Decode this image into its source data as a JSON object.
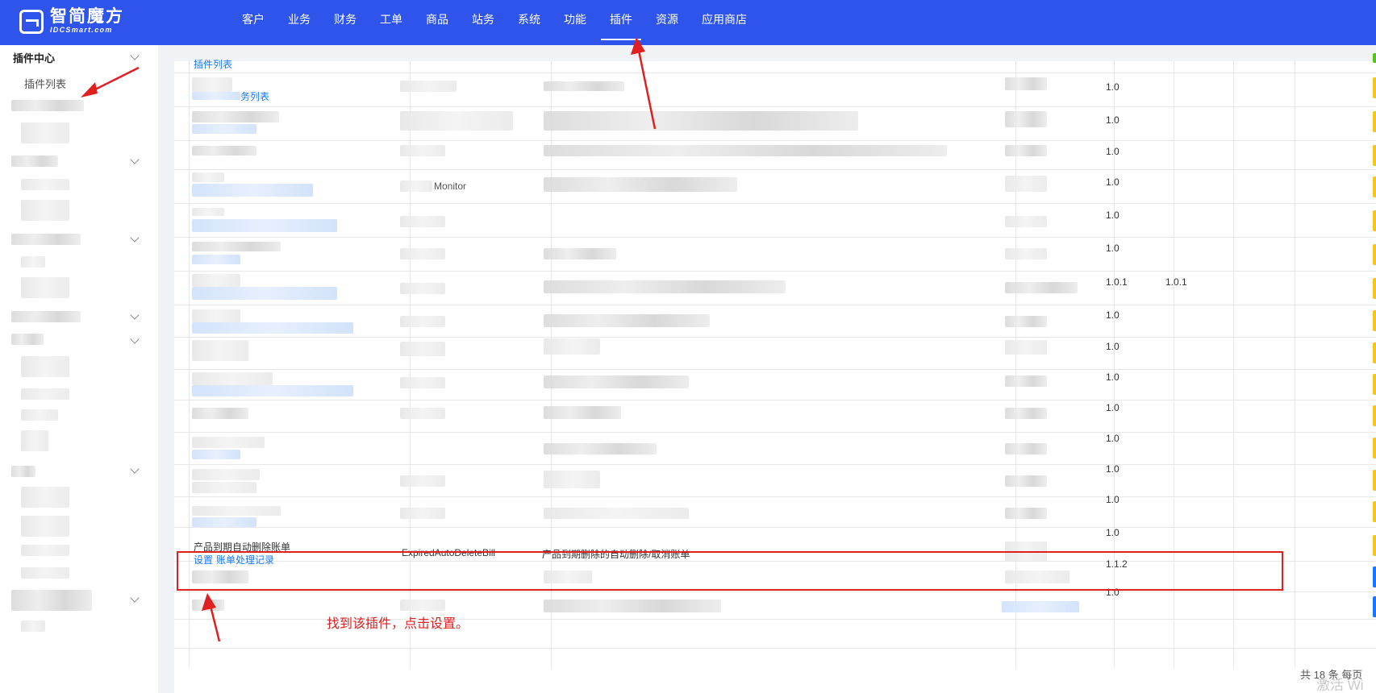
{
  "brand": {
    "name": "智简魔方",
    "sub": "IDCSmart.com"
  },
  "nav": {
    "items": [
      {
        "label": "客户"
      },
      {
        "label": "业务"
      },
      {
        "label": "财务"
      },
      {
        "label": "工单"
      },
      {
        "label": "商品"
      },
      {
        "label": "站务"
      },
      {
        "label": "系统"
      },
      {
        "label": "功能"
      },
      {
        "label": "插件",
        "active": true
      },
      {
        "label": "资源"
      },
      {
        "label": "应用商店"
      }
    ]
  },
  "sidebar": {
    "group_title": "插件中心",
    "active_item": "插件列表"
  },
  "table": {
    "top_link": "插件列表",
    "row2_link": "务列表",
    "versions": [
      "1.0",
      "1.0",
      "1.0",
      "1.0",
      "1.0",
      "1.0",
      "1.0.1",
      "1.0",
      "1.0",
      "1.0",
      "1.0",
      "1.0",
      "1.0",
      "1.0",
      "1.0",
      "1.1.2",
      "1.0"
    ],
    "row7_latest": "1.0.1",
    "row3_mono": "Monitor",
    "highlighted_row": {
      "name": "产品到期自动删除账单",
      "action_settings": "设置",
      "action_records": "账单处理记录",
      "identifier": "ExpiredAutoDeleteBill",
      "description": "产品到期删除的自动删除/取消账单",
      "version": "1.0"
    }
  },
  "annotation": {
    "note": "找到该插件，点击设置。"
  },
  "footer": {
    "total": "共 18 条",
    "per_page": "每页"
  },
  "watermark": "激活 Wi",
  "colors": {
    "topbar": "#2f54eb",
    "annotation": "#e02020",
    "link": "#1677ff",
    "tag": "#f5c518"
  }
}
